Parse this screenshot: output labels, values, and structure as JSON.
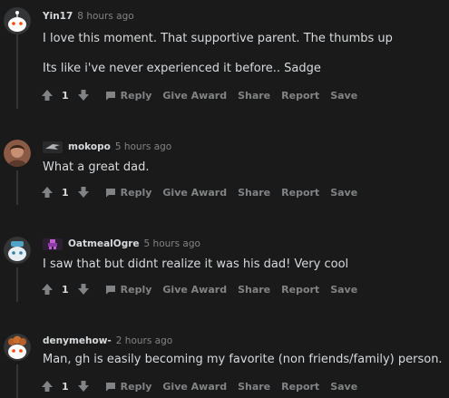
{
  "colors": {
    "background": "#1a1a1b",
    "text": "#d7dadc",
    "muted": "#818384",
    "thread_line": "#343536"
  },
  "comments": [
    {
      "username": "Yin17",
      "time": "8 hours ago",
      "lines": [
        "I love this moment. That supportive parent. The thumbs up",
        "Its like i've never experienced it before.. Sadge"
      ],
      "score": "1",
      "actions": {
        "reply": "Reply",
        "award": "Give Award",
        "share": "Share",
        "report": "Report",
        "save": "Save"
      },
      "avatar_icon": "snoo-default-avatar-icon",
      "flair_icon": ""
    },
    {
      "username": "mokopo",
      "time": "5 hours ago",
      "lines": [
        "What a great dad."
      ],
      "score": "1",
      "actions": {
        "reply": "Reply",
        "award": "Give Award",
        "share": "Share",
        "report": "Report",
        "save": "Save"
      },
      "avatar_icon": "user-photo-avatar-icon",
      "flair_icon": "team-logo-flair-icon"
    },
    {
      "username": "OatmealOgre",
      "time": "5 hours ago",
      "lines": [
        "I saw that but didnt realize it was his dad! Very cool"
      ],
      "score": "1",
      "actions": {
        "reply": "Reply",
        "award": "Give Award",
        "share": "Share",
        "report": "Report",
        "save": "Save"
      },
      "avatar_icon": "snoo-hat-avatar-icon",
      "flair_icon": "pixel-character-flair-icon"
    },
    {
      "username": "denymehow-",
      "time": "2 hours ago",
      "lines": [
        "Man, gh is easily becoming my favorite (non friends/family) person."
      ],
      "score": "1",
      "actions": {
        "reply": "Reply",
        "award": "Give Award",
        "share": "Share",
        "report": "Report",
        "save": "Save"
      },
      "avatar_icon": "snoo-curly-hair-avatar-icon",
      "flair_icon": ""
    }
  ]
}
